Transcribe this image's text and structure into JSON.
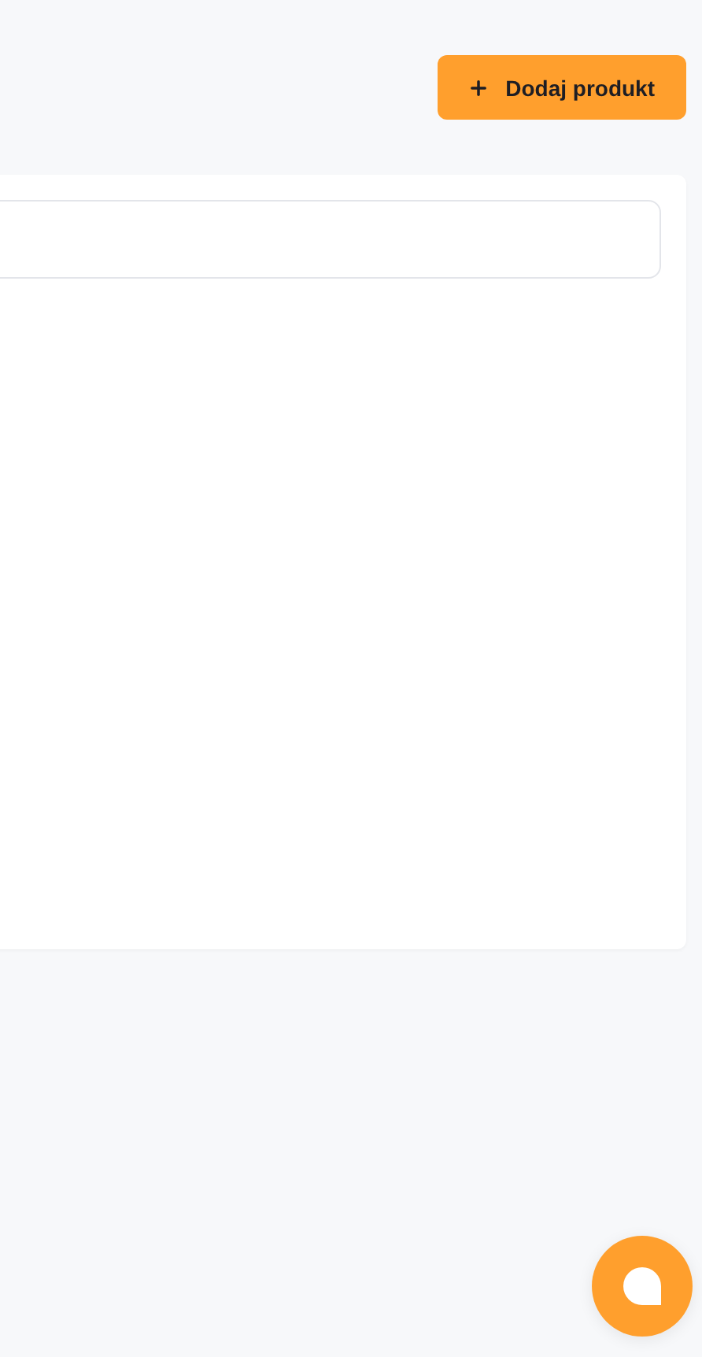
{
  "header": {
    "add_button": {
      "label": "Dodaj produkt"
    }
  },
  "panel": {
    "field": {
      "kind": "input"
    }
  },
  "chat_button": {
    "kind": "chat"
  }
}
